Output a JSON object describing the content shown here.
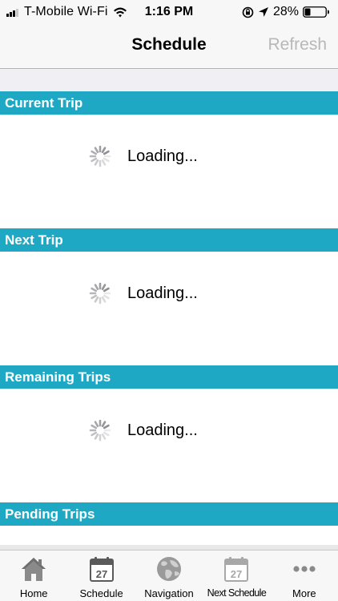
{
  "status_bar": {
    "carrier": "T-Mobile Wi-Fi",
    "time": "1:16 PM",
    "battery": "28%",
    "battery_level": 0.28
  },
  "nav": {
    "title": "Schedule",
    "refresh_label": "Refresh"
  },
  "sections": [
    {
      "title": "Current Trip",
      "loading_text": "Loading..."
    },
    {
      "title": "Next Trip",
      "loading_text": "Loading..."
    },
    {
      "title": "Remaining Trips",
      "loading_text": "Loading..."
    },
    {
      "title": "Pending Trips"
    }
  ],
  "tabs": [
    {
      "label": "Home",
      "icon": "house-icon"
    },
    {
      "label": "Schedule",
      "icon": "calendar-icon",
      "day": "27"
    },
    {
      "label": "Navigation",
      "icon": "globe-icon"
    },
    {
      "label": "Next Schedule",
      "icon": "calendar-icon",
      "day": "27"
    },
    {
      "label": "More",
      "icon": "more-dots-icon"
    }
  ],
  "colors": {
    "section_header": "#1fa8c4",
    "refresh_disabled": "#b8b8b8"
  }
}
